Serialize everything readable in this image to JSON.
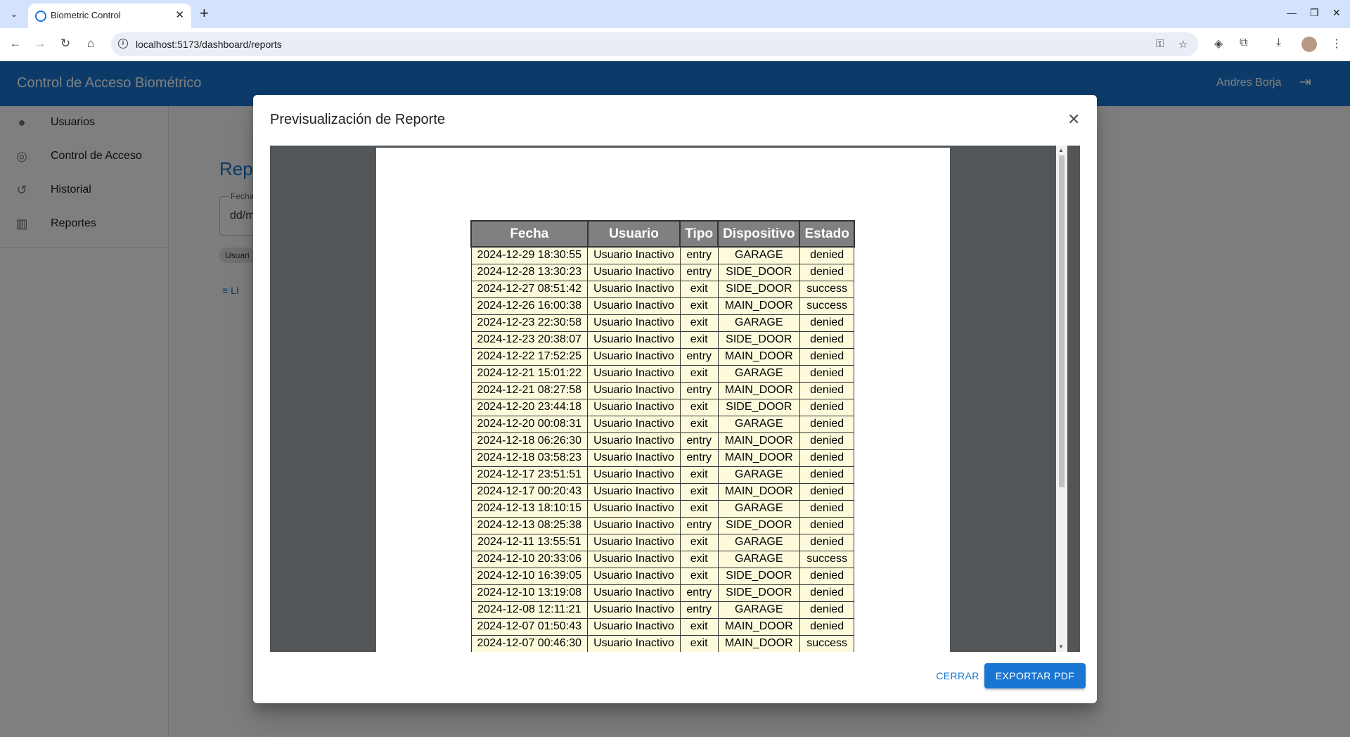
{
  "browser": {
    "tab_title": "Biometric Control",
    "url": "localhost:5173/dashboard/reports"
  },
  "app": {
    "title": "Control de Acceso Biométrico",
    "user": "Andres Borja"
  },
  "sidebar": {
    "items": [
      {
        "label": "Usuarios",
        "icon": "person-icon"
      },
      {
        "label": "Control de Acceso",
        "icon": "fingerprint-icon"
      },
      {
        "label": "Historial",
        "icon": "history-icon"
      },
      {
        "label": "Reportes",
        "icon": "bar-chart-icon"
      }
    ]
  },
  "page": {
    "title": "Repo",
    "date_label": "Fecha",
    "date_value": "dd/m",
    "chip": "Usuari",
    "clear": "LI"
  },
  "dialog": {
    "title": "Previsualización de Reporte",
    "close_label": "CERRAR",
    "export_label": "EXPORTAR PDF"
  },
  "report": {
    "columns": [
      "Fecha",
      "Usuario",
      "Tipo",
      "Dispositivo",
      "Estado"
    ],
    "rows": [
      [
        "2024-12-29 18:30:55",
        "Usuario Inactivo",
        "entry",
        "GARAGE",
        "denied"
      ],
      [
        "2024-12-28 13:30:23",
        "Usuario Inactivo",
        "entry",
        "SIDE_DOOR",
        "denied"
      ],
      [
        "2024-12-27 08:51:42",
        "Usuario Inactivo",
        "exit",
        "SIDE_DOOR",
        "success"
      ],
      [
        "2024-12-26 16:00:38",
        "Usuario Inactivo",
        "exit",
        "MAIN_DOOR",
        "success"
      ],
      [
        "2024-12-23 22:30:58",
        "Usuario Inactivo",
        "exit",
        "GARAGE",
        "denied"
      ],
      [
        "2024-12-23 20:38:07",
        "Usuario Inactivo",
        "exit",
        "SIDE_DOOR",
        "denied"
      ],
      [
        "2024-12-22 17:52:25",
        "Usuario Inactivo",
        "entry",
        "MAIN_DOOR",
        "denied"
      ],
      [
        "2024-12-21 15:01:22",
        "Usuario Inactivo",
        "exit",
        "GARAGE",
        "denied"
      ],
      [
        "2024-12-21 08:27:58",
        "Usuario Inactivo",
        "entry",
        "MAIN_DOOR",
        "denied"
      ],
      [
        "2024-12-20 23:44:18",
        "Usuario Inactivo",
        "exit",
        "SIDE_DOOR",
        "denied"
      ],
      [
        "2024-12-20 00:08:31",
        "Usuario Inactivo",
        "exit",
        "GARAGE",
        "denied"
      ],
      [
        "2024-12-18 06:26:30",
        "Usuario Inactivo",
        "entry",
        "MAIN_DOOR",
        "denied"
      ],
      [
        "2024-12-18 03:58:23",
        "Usuario Inactivo",
        "entry",
        "MAIN_DOOR",
        "denied"
      ],
      [
        "2024-12-17 23:51:51",
        "Usuario Inactivo",
        "exit",
        "GARAGE",
        "denied"
      ],
      [
        "2024-12-17 00:20:43",
        "Usuario Inactivo",
        "exit",
        "MAIN_DOOR",
        "denied"
      ],
      [
        "2024-12-13 18:10:15",
        "Usuario Inactivo",
        "exit",
        "GARAGE",
        "denied"
      ],
      [
        "2024-12-13 08:25:38",
        "Usuario Inactivo",
        "entry",
        "SIDE_DOOR",
        "denied"
      ],
      [
        "2024-12-11 13:55:51",
        "Usuario Inactivo",
        "exit",
        "GARAGE",
        "denied"
      ],
      [
        "2024-12-10 20:33:06",
        "Usuario Inactivo",
        "exit",
        "GARAGE",
        "success"
      ],
      [
        "2024-12-10 16:39:05",
        "Usuario Inactivo",
        "exit",
        "SIDE_DOOR",
        "denied"
      ],
      [
        "2024-12-10 13:19:08",
        "Usuario Inactivo",
        "entry",
        "SIDE_DOOR",
        "denied"
      ],
      [
        "2024-12-08 12:11:21",
        "Usuario Inactivo",
        "entry",
        "GARAGE",
        "denied"
      ],
      [
        "2024-12-07 01:50:43",
        "Usuario Inactivo",
        "exit",
        "MAIN_DOOR",
        "denied"
      ],
      [
        "2024-12-07 00:46:30",
        "Usuario Inactivo",
        "exit",
        "MAIN_DOOR",
        "success"
      ]
    ]
  },
  "colors": {
    "primary": "#1976d2",
    "table_header": "#808080",
    "table_cell": "#fdfbdc",
    "viewer_bg": "#525659"
  }
}
